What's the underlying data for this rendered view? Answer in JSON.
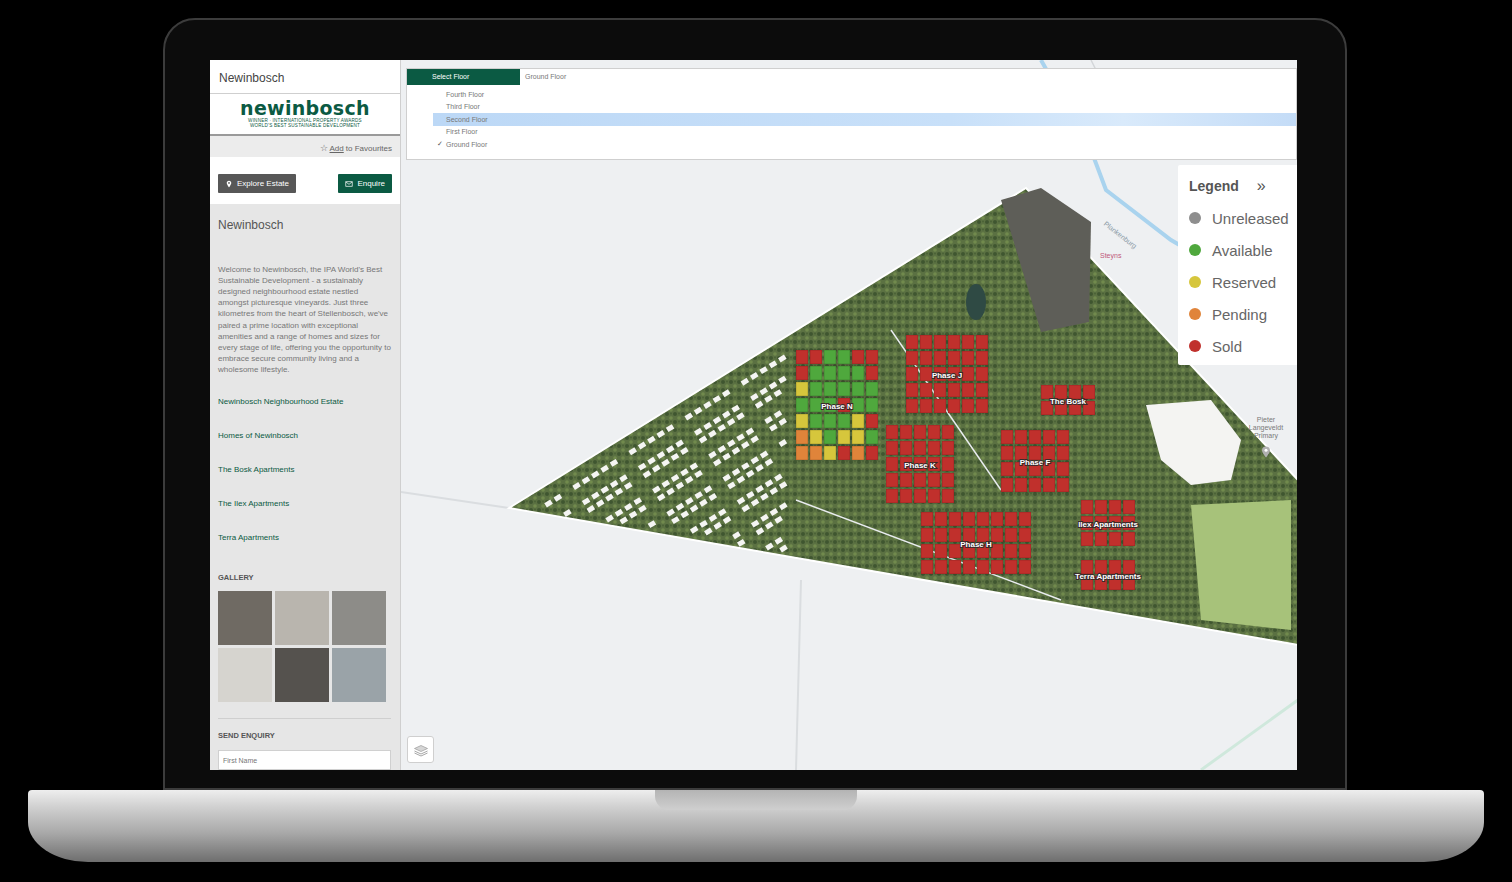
{
  "sidebar": {
    "title": "Newinbosch",
    "logo": {
      "name": "newinbosch",
      "tagline": [
        "WINNER · INTERNATIONAL PROPERTY AWARDS",
        "WORLD'S BEST SUSTAINABLE DEVELOPMENT"
      ]
    },
    "favourite": {
      "icon": "☆",
      "link": "Add",
      "text": "to Favourites"
    },
    "buttons": [
      {
        "label": "Explore Estate",
        "kind": "secondary"
      },
      {
        "label": "Enquire",
        "kind": "primary"
      }
    ],
    "heading": "Newinbosch",
    "description": "Welcome to Newinbosch, the IPA World's Best Sustainable Development - a sustainably designed neighbourhood estate nestled amongst picturesque vineyards. Just three kilometres from the heart of Stellenbosch, we've paired a prime location with exceptional amenities and a range of homes and sizes for every stage of life, offering you the opportunity to embrace secure community living and a wholesome lifestyle.",
    "links": [
      "Newinbosch Neighbourhood Estate",
      "Homes of Newinbosch",
      "The Bosk Apartments",
      "The Ilex Apartments",
      "Terra Apartments"
    ],
    "gallery": {
      "title": "GALLERY"
    },
    "enquiry": {
      "title": "SEND ENQUIRY",
      "placeholder": "First Name"
    }
  },
  "floor_selector": {
    "tab": "Select Floor",
    "current": "Ground Floor",
    "check_icon": "✓",
    "options": [
      {
        "label": "Fourth Floor",
        "selected": false,
        "highlighted": false
      },
      {
        "label": "Third Floor",
        "selected": false,
        "highlighted": false
      },
      {
        "label": "Second Floor",
        "selected": false,
        "highlighted": true
      },
      {
        "label": "First Floor",
        "selected": false,
        "highlighted": false
      },
      {
        "label": "Ground Floor",
        "selected": true,
        "highlighted": false
      }
    ]
  },
  "legend": {
    "title": "Legend",
    "collapse_icon": "»",
    "items": [
      {
        "label": "Unreleased",
        "color": "#8e8e8e"
      },
      {
        "label": "Available",
        "color": "#4fa83d"
      },
      {
        "label": "Reserved",
        "color": "#d6c63c"
      },
      {
        "label": "Pending",
        "color": "#e0843a"
      },
      {
        "label": "Sold",
        "color": "#c0302c"
      }
    ]
  },
  "map": {
    "labels": [
      "Plankenburg",
      "Steyns",
      "Pieter Langeveldt Primary"
    ],
    "phases": [
      {
        "label": "Phase N",
        "plots": [
          "Sold",
          "Sold",
          "Available",
          "Available",
          "Sold",
          "Sold",
          "Sold",
          "Available",
          "Available",
          "Available",
          "Available",
          "Sold",
          "Reserved",
          "Available",
          "Available",
          "Available",
          "Available",
          "Available",
          "Available",
          "Available",
          "Available",
          "Sold",
          "Available",
          "Available",
          "Reserved",
          "Available",
          "Available",
          "Available",
          "Reserved",
          "Sold",
          "Pending",
          "Reserved",
          "Available",
          "Reserved",
          "Reserved",
          "Available",
          "Pending",
          "Pending",
          "Reserved",
          "Sold",
          "Pending",
          "Sold"
        ]
      },
      {
        "label": "Phase J",
        "plots": [
          "Sold",
          "Sold",
          "Sold",
          "Sold",
          "Sold",
          "Sold",
          "Sold",
          "Sold",
          "Sold",
          "Sold",
          "Sold",
          "Sold",
          "Sold",
          "Sold",
          "Sold",
          "Sold",
          "Sold",
          "Sold",
          "Sold",
          "Sold",
          "Sold",
          "Sold",
          "Sold",
          "Sold",
          "Sold",
          "Sold",
          "Sold",
          "Sold",
          "Sold",
          "Sold"
        ]
      },
      {
        "label": "Phase K",
        "plots": [
          "Sold",
          "Sold",
          "Sold",
          "Sold",
          "Sold",
          "Sold",
          "Sold",
          "Sold",
          "Sold",
          "Sold",
          "Sold",
          "Sold",
          "Sold",
          "Sold",
          "Sold",
          "Sold",
          "Sold",
          "Sold",
          "Sold",
          "Sold",
          "Sold",
          "Sold",
          "Sold",
          "Sold",
          "Sold"
        ]
      },
      {
        "label": "Phase F",
        "plots": [
          "Sold",
          "Sold",
          "Sold",
          "Sold",
          "Sold",
          "Sold",
          "Sold",
          "Sold",
          "Sold",
          "Sold",
          "Sold",
          "Sold",
          "Sold",
          "Sold",
          "Sold",
          "Sold",
          "Sold",
          "Sold",
          "Sold",
          "Sold"
        ]
      },
      {
        "label": "Phase H",
        "plots": [
          "Sold",
          "Sold",
          "Sold",
          "Sold",
          "Sold",
          "Sold",
          "Sold",
          "Sold",
          "Sold",
          "Sold",
          "Sold",
          "Sold",
          "Sold",
          "Sold",
          "Sold",
          "Sold",
          "Sold",
          "Sold",
          "Sold",
          "Sold",
          "Sold",
          "Sold",
          "Sold",
          "Sold",
          "Sold",
          "Sold",
          "Sold",
          "Sold",
          "Sold",
          "Sold",
          "Sold",
          "Sold"
        ]
      },
      {
        "label": "The Bosk",
        "plots": [
          "Sold",
          "Sold",
          "Sold",
          "Sold",
          "Sold",
          "Sold",
          "Sold",
          "Sold"
        ]
      },
      {
        "label": "Ilex Apartments",
        "plots": [
          "Sold",
          "Sold",
          "Sold",
          "Sold",
          "Sold",
          "Sold",
          "Sold",
          "Sold",
          "Sold",
          "Sold",
          "Sold",
          "Sold"
        ]
      },
      {
        "label": "Terra Apartments",
        "plots": [
          "Sold",
          "Sold",
          "Sold",
          "Sold",
          "Sold",
          "Sold",
          "Sold",
          "Sold"
        ]
      }
    ]
  }
}
